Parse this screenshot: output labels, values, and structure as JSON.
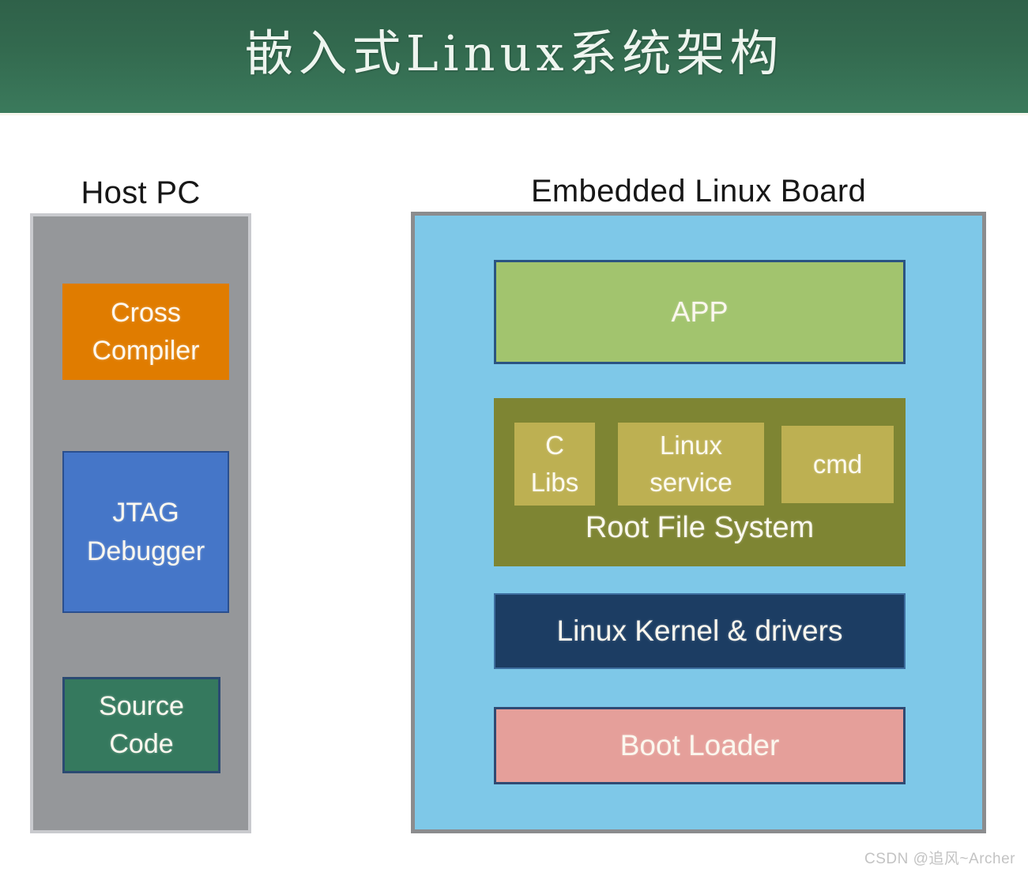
{
  "banner": {
    "title": "嵌入式Linux系统架构",
    "background_color": "#336a4f",
    "text_color": "#eef5ef"
  },
  "host_pc": {
    "caption": "Host PC",
    "panel_color": "#95979a",
    "panel_border_color": "#c9cace",
    "boxes": [
      {
        "label": "Cross\nCompiler",
        "line1": "Cross",
        "line2": "Compiler",
        "color": "#e07c00"
      },
      {
        "label": "JTAG\nDebugger",
        "line1": "JTAG",
        "line2": "Debugger",
        "color": "#4576c8"
      },
      {
        "label": "Source\nCode",
        "line1": "Source",
        "line2": "Code",
        "color": "#35795e"
      }
    ]
  },
  "board": {
    "caption": "Embedded Linux Board",
    "panel_color": "#7ec8e8",
    "panel_border_color": "#8b8c8e",
    "layers": [
      {
        "name": "app",
        "label": "APP",
        "color": "#a2c46e"
      },
      {
        "name": "rootfs",
        "label": "Root File System",
        "color": "#7e8533"
      },
      {
        "name": "kernel",
        "label": "Linux Kernel & drivers",
        "color": "#1c3d63"
      },
      {
        "name": "bootloader",
        "label": "Boot Loader",
        "color": "#e59f9a"
      }
    ],
    "rootfs": {
      "title": "Root File System",
      "color": "#7e8533",
      "sub_color": "#bdb052",
      "components": [
        {
          "line1": "C",
          "line2": "Libs"
        },
        {
          "line1": "Linux",
          "line2": "service"
        },
        {
          "line1": "cmd",
          "line2": ""
        }
      ]
    },
    "app_label": "APP",
    "kernel_label": "Linux Kernel & drivers",
    "bootloader_label": "Boot Loader"
  },
  "watermark": {
    "text": "CSDN @追风~Archer",
    "color": "#c3c3c3"
  }
}
